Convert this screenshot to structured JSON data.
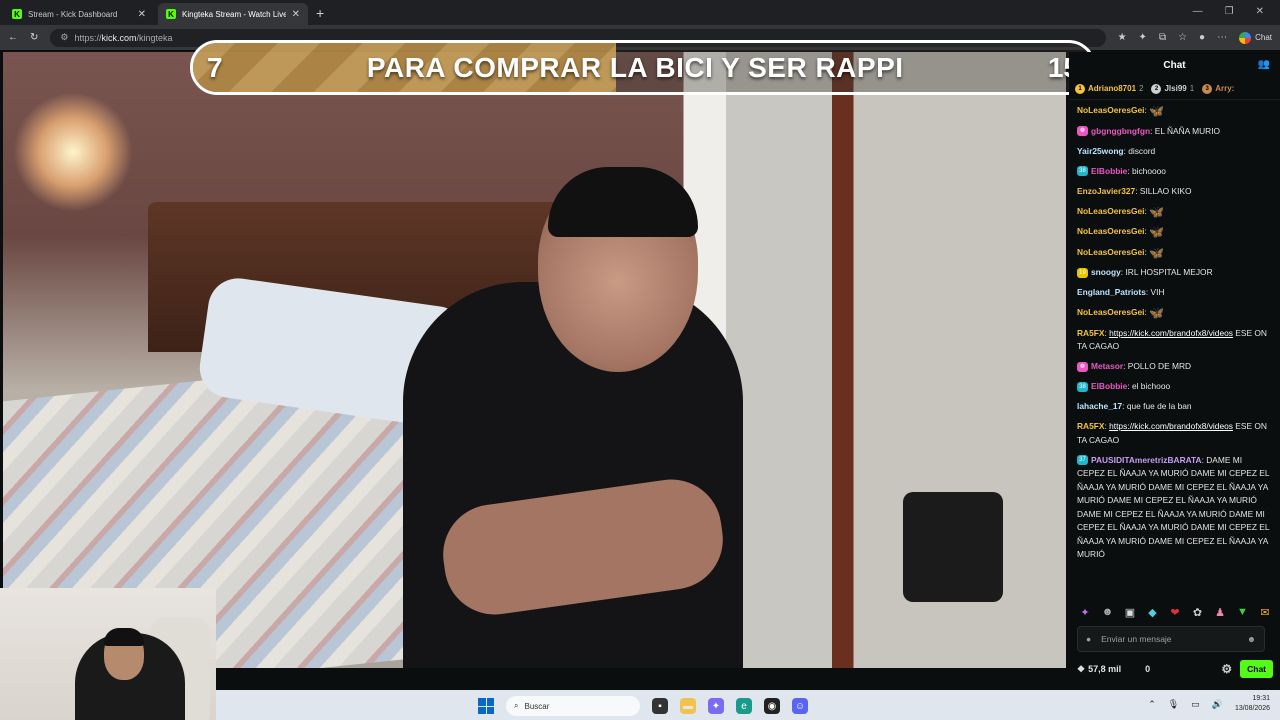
{
  "browser": {
    "tabs": [
      {
        "title": "Stream - Kick Dashboard",
        "active": false
      },
      {
        "title": "Kingteka Stream - Watch Live on Kick",
        "active": true
      }
    ],
    "new_tab_icon": "plus-icon",
    "url_prefix": "https://",
    "url_host": "kick.com",
    "url_path": "/kingteka",
    "chat_button_label": "Chat"
  },
  "overlay": {
    "goal_start": "7",
    "goal_text": "PARA COMPRAR LA BICI Y SER RAPPI",
    "goal_end": "15",
    "goal_progress": 0.47
  },
  "chat": {
    "title": "Chat",
    "leaders": [
      {
        "name": "Adriano8701",
        "count": "2",
        "color": "#f5c242"
      },
      {
        "name": "Jlsi99",
        "count": "1",
        "color": "#d0d0d0"
      },
      {
        "name": "Arry:",
        "count": "",
        "color": "#c98a4b"
      }
    ],
    "messages": [
      {
        "badge": "",
        "badge_color": "",
        "user": "NoLeasOeresGei",
        "user_color": "#f5c242",
        "text": "",
        "emote": true
      },
      {
        "badge": "❁",
        "badge_color": "#e858c0",
        "user": "gbgnggbngfgn",
        "user_color": "#e858c0",
        "text": "EL ÑAÑA MURIO",
        "emote": false
      },
      {
        "badge": "",
        "badge_color": "",
        "user": "Yair25wong",
        "user_color": "#bde3ff",
        "text": "discord",
        "emote": false
      },
      {
        "badge": "38",
        "badge_color": "#1fb6c9",
        "user": "ElBobbie",
        "user_color": "#e858c0",
        "text": "bichoooo",
        "emote": false
      },
      {
        "badge": "",
        "badge_color": "",
        "user": "EnzoJavier327",
        "user_color": "#f5c242",
        "text": "SILLAO KIKO",
        "emote": false
      },
      {
        "badge": "",
        "badge_color": "",
        "user": "NoLeasOeresGei",
        "user_color": "#f5c242",
        "text": "",
        "emote": true
      },
      {
        "badge": "",
        "badge_color": "",
        "user": "NoLeasOeresGei",
        "user_color": "#f5c242",
        "text": "",
        "emote": true
      },
      {
        "badge": "",
        "badge_color": "",
        "user": "NoLeasOeresGei",
        "user_color": "#f5c242",
        "text": "",
        "emote": true
      },
      {
        "badge": "19",
        "badge_color": "#e8c400",
        "user": "snoogy",
        "user_color": "#bde3ff",
        "text": "IRL HOSPITAL MEJOR",
        "emote": false
      },
      {
        "badge": "",
        "badge_color": "",
        "user": "England_Patriots",
        "user_color": "#bde3ff",
        "text": "VIH",
        "emote": false
      },
      {
        "badge": "",
        "badge_color": "",
        "user": "NoLeasOeresGei",
        "user_color": "#f5c242",
        "text": "",
        "emote": true
      },
      {
        "badge": "",
        "badge_color": "",
        "user": "RA5FX",
        "user_color": "#f5c242",
        "text": "ESE ON TA CAGAO",
        "link": "https://kick.com/brandofx8/videos",
        "emote": false
      },
      {
        "badge": "❁",
        "badge_color": "#e858c0",
        "user": "Metasor",
        "user_color": "#e858c0",
        "text": "POLLO DE MRD",
        "emote": false
      },
      {
        "badge": "38",
        "badge_color": "#1fb6c9",
        "user": "ElBobbie",
        "user_color": "#e858c0",
        "text": "el bichooo",
        "emote": false
      },
      {
        "badge": "",
        "badge_color": "",
        "user": "lahache_17",
        "user_color": "#bde3ff",
        "text": "que fue de la ban",
        "emote": false
      },
      {
        "badge": "",
        "badge_color": "",
        "user": "RA5FX",
        "user_color": "#f5c242",
        "text": "ESE ON TA CAGAO",
        "link": "https://kick.com/brandofx8/videos",
        "emote": false
      },
      {
        "badge": "37",
        "badge_color": "#1fb6c9",
        "user": "PAUSIDITAmeretrizBARATA",
        "user_color": "#c79cf7",
        "text": "DAME MI CEPEZ EL ÑAAJA YA MURIÓ DAME MI CEPEZ EL ÑAAJA YA MURIÓ DAME MI CEPEZ EL ÑAAJA YA MURIÓ DAME MI CEPEZ EL ÑAAJA YA MURIÓ DAME MI CEPEZ EL ÑAAJA YA MURIÓ DAME MI CEPEZ EL ÑAAJA YA MURIÓ DAME MI CEPEZ EL ÑAAJA YA MURIÓ DAME MI CEPEZ EL ÑAAJA YA MURIÓ",
        "emote": false
      }
    ],
    "input_placeholder": "Enviar un mensaje",
    "points": "57,8 mil",
    "zero_count": "0",
    "send_label": "Chat"
  },
  "taskbar": {
    "search_placeholder": "Buscar",
    "time": "19:31",
    "date": "13/08/2026"
  }
}
